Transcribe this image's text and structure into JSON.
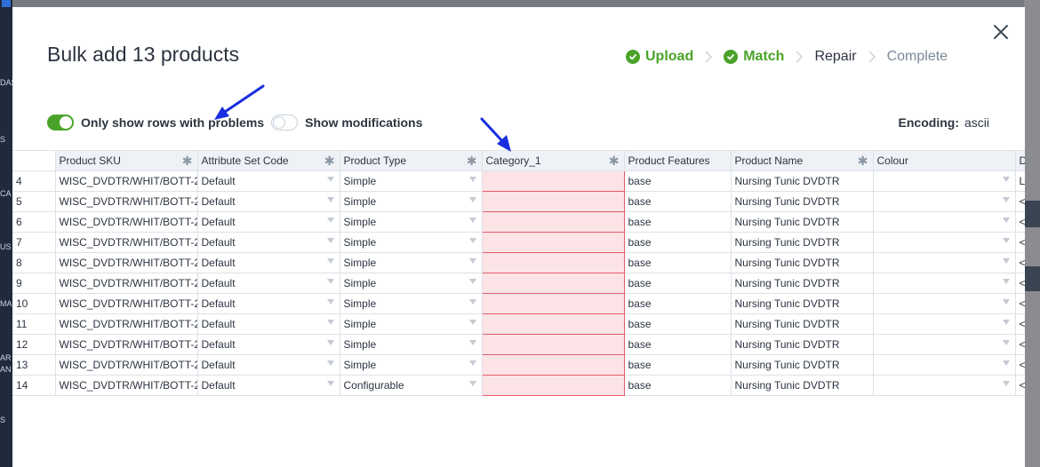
{
  "modal": {
    "title": "Bulk add 13 products"
  },
  "steps": [
    {
      "label": "Upload",
      "state": "done"
    },
    {
      "label": "Match",
      "state": "done"
    },
    {
      "label": "Repair",
      "state": "active"
    },
    {
      "label": "Complete",
      "state": "todo"
    }
  ],
  "toolbar": {
    "problems_label": "Only show rows with problems",
    "problems_on": true,
    "modifications_label": "Show modifications",
    "modifications_on": false,
    "encoding_label": "Encoding:",
    "encoding_value": "ascii"
  },
  "table": {
    "columns": [
      {
        "label": "Product SKU",
        "required": true
      },
      {
        "label": "Attribute Set Code",
        "required": true
      },
      {
        "label": "Product Type",
        "required": true
      },
      {
        "label": "Category_1",
        "required": true
      },
      {
        "label": "Product Features",
        "required": false
      },
      {
        "label": "Product Name",
        "required": true
      },
      {
        "label": "Colour",
        "required": false
      },
      {
        "label": "D",
        "required": false
      }
    ],
    "rows": [
      {
        "num": "4",
        "sku": "WISC_DVDTR/WHIT/BOTT-2",
        "attr_set": "Default",
        "type": "Simple",
        "category": "",
        "features": "base",
        "name": "Nursing Tunic DVDTR",
        "colour": "",
        "last": "L"
      },
      {
        "num": "5",
        "sku": "WISC_DVDTR/WHIT/BOTT-2",
        "attr_set": "Default",
        "type": "Simple",
        "category": "",
        "features": "base",
        "name": "Nursing Tunic DVDTR",
        "colour": "",
        "last": "<"
      },
      {
        "num": "6",
        "sku": "WISC_DVDTR/WHIT/BOTT-2",
        "attr_set": "Default",
        "type": "Simple",
        "category": "",
        "features": "base",
        "name": "Nursing Tunic DVDTR",
        "colour": "",
        "last": "<"
      },
      {
        "num": "7",
        "sku": "WISC_DVDTR/WHIT/BOTT-2",
        "attr_set": "Default",
        "type": "Simple",
        "category": "",
        "features": "base",
        "name": "Nursing Tunic DVDTR",
        "colour": "",
        "last": "<"
      },
      {
        "num": "8",
        "sku": "WISC_DVDTR/WHIT/BOTT-2",
        "attr_set": "Default",
        "type": "Simple",
        "category": "",
        "features": "base",
        "name": "Nursing Tunic DVDTR",
        "colour": "",
        "last": "<"
      },
      {
        "num": "9",
        "sku": "WISC_DVDTR/WHIT/BOTT-2",
        "attr_set": "Default",
        "type": "Simple",
        "category": "",
        "features": "base",
        "name": "Nursing Tunic DVDTR",
        "colour": "",
        "last": "<"
      },
      {
        "num": "10",
        "sku": "WISC_DVDTR/WHIT/BOTT-2",
        "attr_set": "Default",
        "type": "Simple",
        "category": "",
        "features": "base",
        "name": "Nursing Tunic DVDTR",
        "colour": "",
        "last": "<"
      },
      {
        "num": "11",
        "sku": "WISC_DVDTR/WHIT/BOTT-2",
        "attr_set": "Default",
        "type": "Simple",
        "category": "",
        "features": "base",
        "name": "Nursing Tunic DVDTR",
        "colour": "",
        "last": "<"
      },
      {
        "num": "12",
        "sku": "WISC_DVDTR/WHIT/BOTT-2",
        "attr_set": "Default",
        "type": "Simple",
        "category": "",
        "features": "base",
        "name": "Nursing Tunic DVDTR",
        "colour": "",
        "last": "<"
      },
      {
        "num": "13",
        "sku": "WISC_DVDTR/WHIT/BOTT-2",
        "attr_set": "Default",
        "type": "Simple",
        "category": "",
        "features": "base",
        "name": "Nursing Tunic DVDTR",
        "colour": "",
        "last": "<"
      },
      {
        "num": "14",
        "sku": "WISC_DVDTR/WHIT/BOTT-2",
        "attr_set": "Default",
        "type": "Configurable",
        "category": "",
        "features": "base",
        "name": "Nursing Tunic DVDTR",
        "colour": "",
        "last": "<"
      }
    ]
  },
  "background": {
    "sidebar_fragments": [
      "DAS",
      "S",
      "CA",
      "US",
      "MA",
      "AR",
      "AN",
      "S"
    ]
  },
  "colors": {
    "success": "#4aa329",
    "error_fill": "#fbe3e6",
    "error_border": "#e35d6a",
    "annotation_arrow": "#1a2ee0"
  },
  "icons": {
    "close": "close-icon",
    "step_done": "check-circle-icon",
    "step_separator": "chevron-right-icon",
    "required": "asterisk-icon",
    "dropdown": "caret-down-icon",
    "annotation": "arrow-icon"
  }
}
